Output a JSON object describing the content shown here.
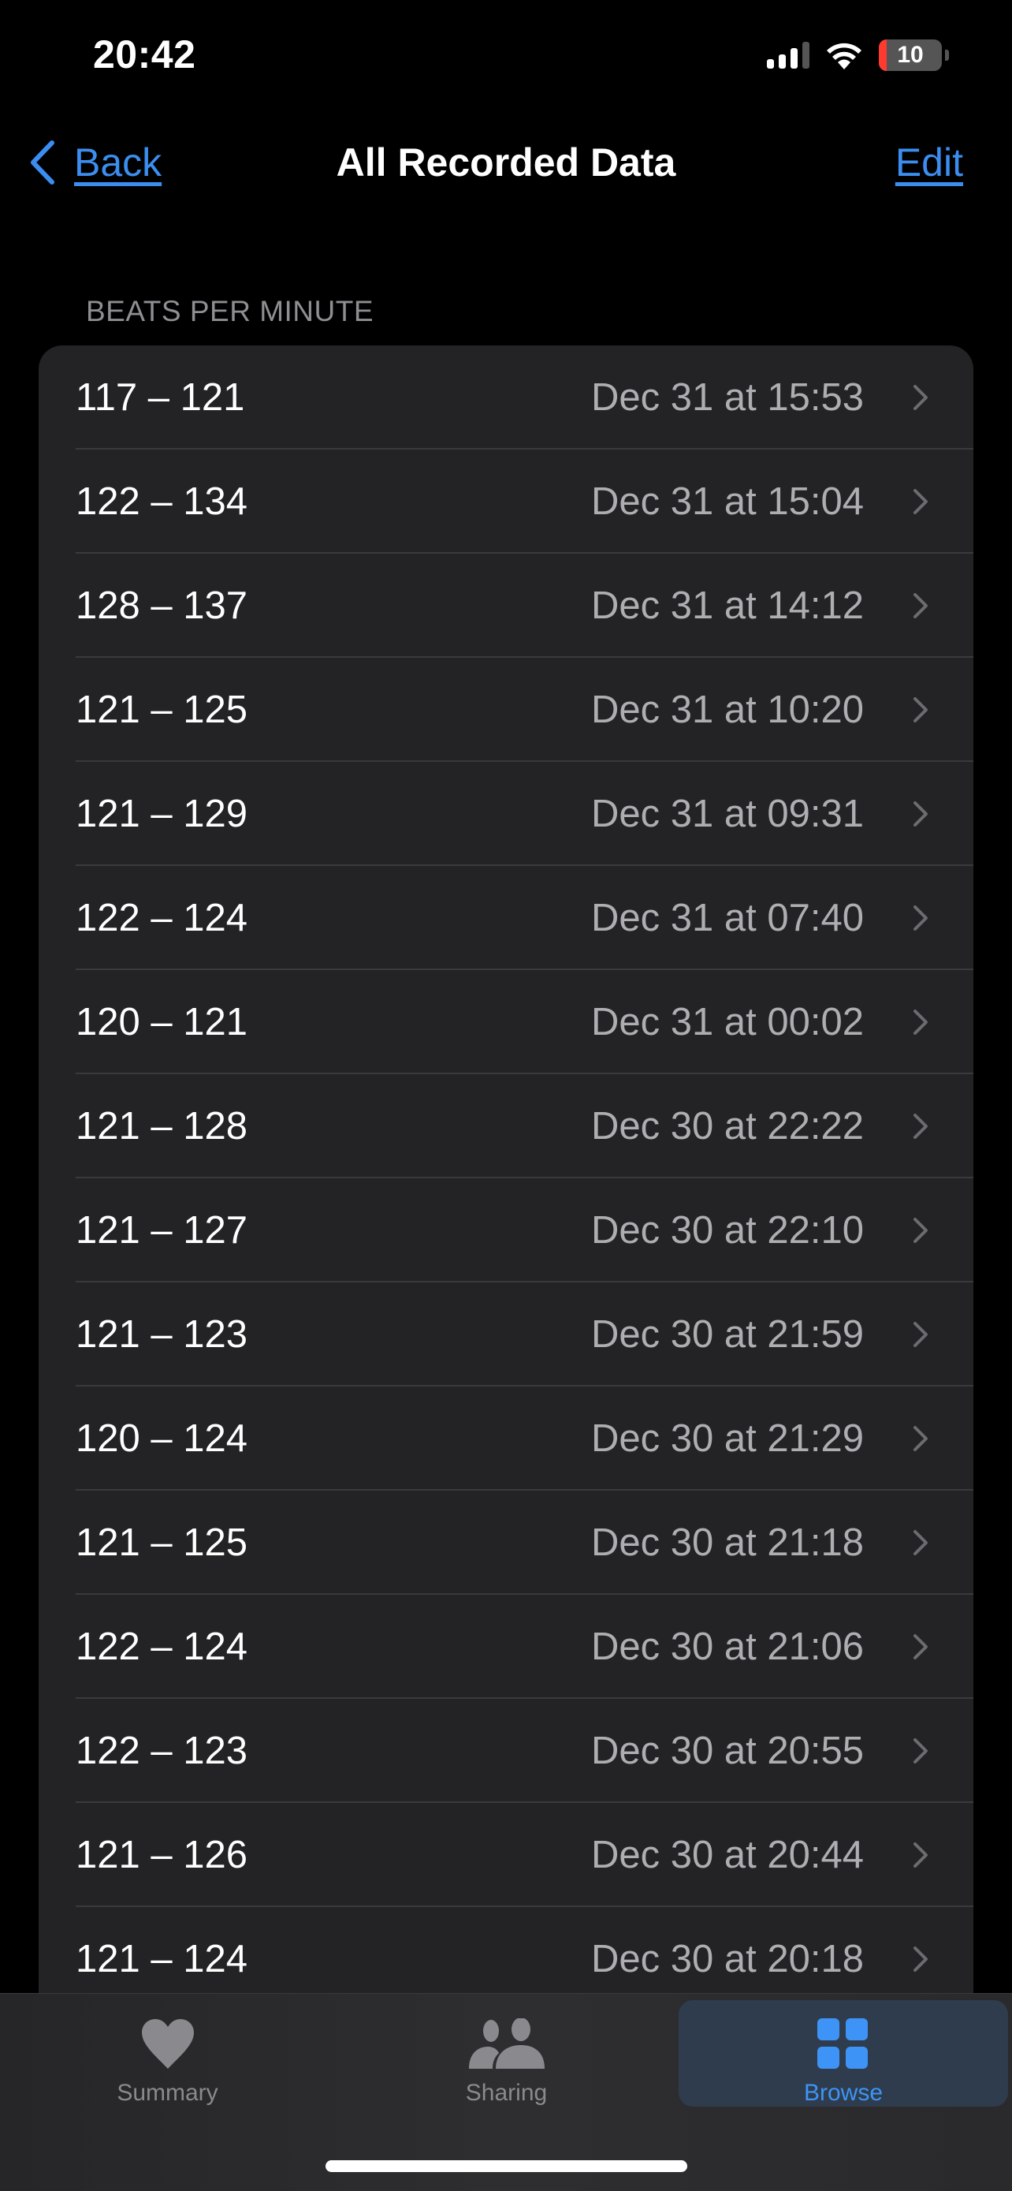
{
  "status_bar": {
    "time": "20:42",
    "battery_level": "10",
    "battery_color": "#ff3b30"
  },
  "nav": {
    "back_label": "Back",
    "title": "All Recorded Data",
    "edit_label": "Edit",
    "accent_color": "#3b8ef0"
  },
  "section": {
    "header": "BEATS PER MINUTE",
    "rows": [
      {
        "range": "117 – 121",
        "date": "Dec 31 at 15:53"
      },
      {
        "range": "122 – 134",
        "date": "Dec 31 at 15:04"
      },
      {
        "range": "128 – 137",
        "date": "Dec 31 at 14:12"
      },
      {
        "range": "121 – 125",
        "date": "Dec 31 at 10:20"
      },
      {
        "range": "121 – 129",
        "date": "Dec 31 at 09:31"
      },
      {
        "range": "122 – 124",
        "date": "Dec 31 at 07:40"
      },
      {
        "range": "120 – 121",
        "date": "Dec 31 at 00:02"
      },
      {
        "range": "121 – 128",
        "date": "Dec 30 at 22:22"
      },
      {
        "range": "121 – 127",
        "date": "Dec 30 at 22:10"
      },
      {
        "range": "121 – 123",
        "date": "Dec 30 at 21:59"
      },
      {
        "range": "120 – 124",
        "date": "Dec 30 at 21:29"
      },
      {
        "range": "121 – 125",
        "date": "Dec 30 at 21:18"
      },
      {
        "range": "122 – 124",
        "date": "Dec 30 at 21:06"
      },
      {
        "range": "122 – 123",
        "date": "Dec 30 at 20:55"
      },
      {
        "range": "121 – 126",
        "date": "Dec 30 at 20:44"
      },
      {
        "range": "121 – 124",
        "date": "Dec 30 at 20:18"
      }
    ]
  },
  "tab_bar": {
    "tabs": [
      {
        "label": "Summary",
        "icon": "heart-icon",
        "selected": false
      },
      {
        "label": "Sharing",
        "icon": "people-icon",
        "selected": false
      },
      {
        "label": "Browse",
        "icon": "grid-icon",
        "selected": true
      }
    ],
    "selected_color": "#3d94f6",
    "unselected_color": "#8a8a8e"
  }
}
